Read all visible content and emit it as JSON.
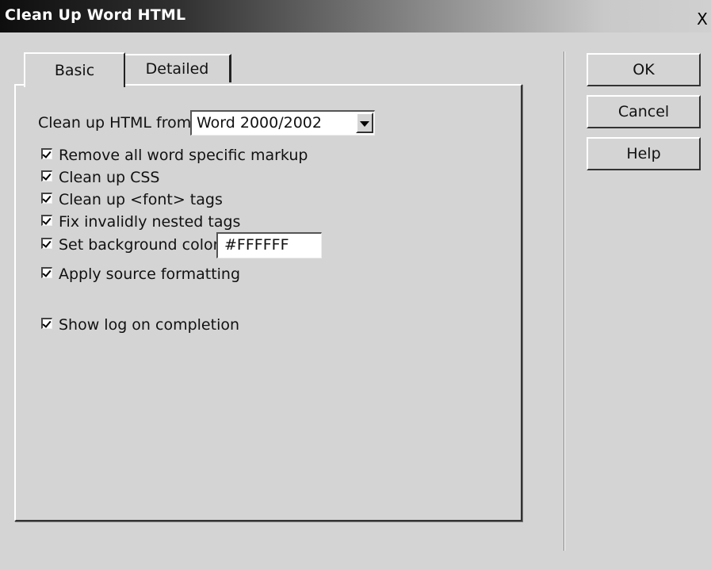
{
  "window": {
    "title": "Clean Up Word HTML",
    "close_glyph": "X"
  },
  "tabs": [
    {
      "label": "Basic",
      "selected": true
    },
    {
      "label": "Detailed",
      "selected": false
    }
  ],
  "clean_from": {
    "label": "Clean up HTML from",
    "value": "Word 2000/2002"
  },
  "options": [
    {
      "label": "Remove all word specific markup",
      "checked": true
    },
    {
      "label": "Clean up CSS",
      "checked": true
    },
    {
      "label": "Clean up <font> tags",
      "checked": true
    },
    {
      "label": "Fix invalidly nested tags",
      "checked": true
    },
    {
      "label": "Set background color",
      "checked": true
    },
    {
      "label": "Apply source formatting",
      "checked": true
    },
    {
      "label": "Show log on completion",
      "checked": true
    }
  ],
  "background_color_value": "#FFFFFF",
  "buttons": {
    "ok": "OK",
    "cancel": "Cancel",
    "help": "Help"
  }
}
